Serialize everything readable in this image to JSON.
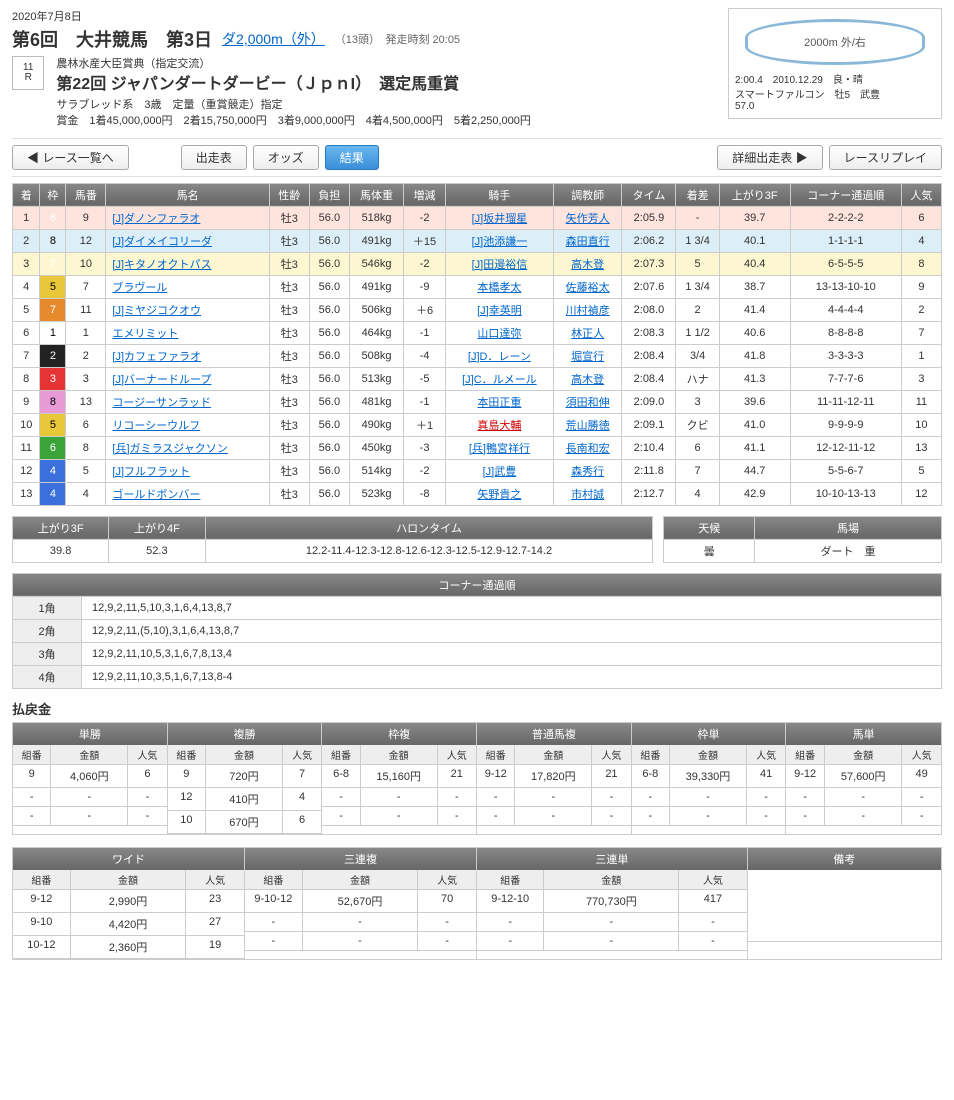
{
  "header": {
    "date": "2020年7月8日",
    "meeting": "第6回　大井競馬　第3日",
    "dist": "ダ2,000m（外）",
    "info": "（13頭）　発走時刻 20:05",
    "sub1": "農林水産大臣賞典（指定交流）",
    "race_name": "第22回 ジャパンダートダービー（ＪｐｎI）　選定馬重賞",
    "sub2": "サラブレッド系　3歳　定量（重賞競走）指定",
    "prize": "賞金　1着45,000,000円　2着15,750,000円　3着9,000,000円　4着4,500,000円　5着2,250,000円",
    "race_num": "11",
    "race_num_sub": "R"
  },
  "record": {
    "oval": "2000m  外/右",
    "line1": "2:00.4　2010.12.29　良・晴",
    "line2": "スマートファルコン　牡5　武豊",
    "line3": "57.0"
  },
  "tabs": {
    "back": "◀ レース一覧へ",
    "t1": "出走表",
    "t2": "オッズ",
    "t3": "結果",
    "r1": "詳細出走表 ▶",
    "r2": "レースリプレイ"
  },
  "cols": [
    "着",
    "枠",
    "馬番",
    "馬名",
    "性齢",
    "負担",
    "馬体重",
    "増減",
    "騎手",
    "調教師",
    "タイム",
    "着差",
    "上がり3F",
    "コーナー通過順",
    "人気"
  ],
  "rows": [
    {
      "p": "1",
      "w": 6,
      "n": 9,
      "name": "[J]ダノンファラオ",
      "sa": "牡3",
      "wt": "56.0",
      "bw": "518kg",
      "d": "-2",
      "j": "[J]坂井瑠星",
      "t": "矢作芳人",
      "time": "2:05.9",
      "mg": "-",
      "f3": "39.7",
      "cn": "2-2-2-2",
      "pop": "6"
    },
    {
      "p": "2",
      "w": 8,
      "n": 12,
      "name": "[J]ダイメイコリーダ",
      "sa": "牡3",
      "wt": "56.0",
      "bw": "491kg",
      "d": "＋15",
      "j": "[J]池添謙一",
      "t": "森田直行",
      "time": "2:06.2",
      "mg": "1 3/4",
      "f3": "40.1",
      "cn": "1-1-1-1",
      "pop": "4"
    },
    {
      "p": "3",
      "w": 7,
      "n": 10,
      "name": "[J]キタノオクトパス",
      "sa": "牡3",
      "wt": "56.0",
      "bw": "546kg",
      "d": "-2",
      "j": "[J]田邊裕信",
      "t": "高木登",
      "time": "2:07.3",
      "mg": "5",
      "f3": "40.4",
      "cn": "6-5-5-5",
      "pop": "8"
    },
    {
      "p": "4",
      "w": 5,
      "n": 7,
      "name": "ブラヴール",
      "sa": "牡3",
      "wt": "56.0",
      "bw": "491kg",
      "d": "-9",
      "j": "本橋孝太",
      "t": "佐藤裕太",
      "time": "2:07.6",
      "mg": "1 3/4",
      "f3": "38.7",
      "cn": "13-13-10-10",
      "pop": "9"
    },
    {
      "p": "5",
      "w": 7,
      "n": 11,
      "name": "[J]ミヤジコクオウ",
      "sa": "牡3",
      "wt": "56.0",
      "bw": "506kg",
      "d": "＋6",
      "j": "[J]幸英明",
      "t": "川村禎彦",
      "time": "2:08.0",
      "mg": "2",
      "f3": "41.4",
      "cn": "4-4-4-4",
      "pop": "2"
    },
    {
      "p": "6",
      "w": 1,
      "n": 1,
      "name": "エメリミット",
      "sa": "牡3",
      "wt": "56.0",
      "bw": "464kg",
      "d": "-1",
      "j": "山口達弥",
      "t": "林正人",
      "time": "2:08.3",
      "mg": "1 1/2",
      "f3": "40.6",
      "cn": "8-8-8-8",
      "pop": "7"
    },
    {
      "p": "7",
      "w": 2,
      "n": 2,
      "name": "[J]カフェファラオ",
      "sa": "牡3",
      "wt": "56.0",
      "bw": "508kg",
      "d": "-4",
      "j": "[J]D．レーン",
      "t": "堀宣行",
      "time": "2:08.4",
      "mg": "3/4",
      "f3": "41.8",
      "cn": "3-3-3-3",
      "pop": "1"
    },
    {
      "p": "8",
      "w": 3,
      "n": 3,
      "name": "[J]バーナードループ",
      "sa": "牡3",
      "wt": "56.0",
      "bw": "513kg",
      "d": "-5",
      "j": "[J]C．ルメール",
      "t": "高木登",
      "time": "2:08.4",
      "mg": "ハナ",
      "f3": "41.3",
      "cn": "7-7-7-6",
      "pop": "3"
    },
    {
      "p": "9",
      "w": 8,
      "n": 13,
      "name": "コージーサンラッド",
      "sa": "牡3",
      "wt": "56.0",
      "bw": "481kg",
      "d": "-1",
      "j": "本田正重",
      "t": "須田和伸",
      "time": "2:09.0",
      "mg": "3",
      "f3": "39.6",
      "cn": "11-11-12-11",
      "pop": "11"
    },
    {
      "p": "10",
      "w": 5,
      "n": 6,
      "name": "リコーシーウルフ",
      "sa": "牡3",
      "wt": "56.0",
      "bw": "490kg",
      "d": "＋1",
      "j": "真島大輔",
      "t": "荒山勝徳",
      "time": "2:09.1",
      "mg": "クビ",
      "f3": "41.0",
      "cn": "9-9-9-9",
      "pop": "10",
      "jred": true
    },
    {
      "p": "11",
      "w": 6,
      "n": 8,
      "name": "[兵]ガミラスジャクソン",
      "sa": "牡3",
      "wt": "56.0",
      "bw": "450kg",
      "d": "-3",
      "j": "[兵]鴨宮祥行",
      "t": "長南和宏",
      "time": "2:10.4",
      "mg": "6",
      "f3": "41.1",
      "cn": "12-12-11-12",
      "pop": "13"
    },
    {
      "p": "12",
      "w": 4,
      "n": 5,
      "name": "[J]フルフラット",
      "sa": "牡3",
      "wt": "56.0",
      "bw": "514kg",
      "d": "-2",
      "j": "[J]武豊",
      "t": "森秀行",
      "time": "2:11.8",
      "mg": "7",
      "f3": "44.7",
      "cn": "5-5-6-7",
      "pop": "5"
    },
    {
      "p": "13",
      "w": 4,
      "n": 4,
      "name": "ゴールドボンバー",
      "sa": "牡3",
      "wt": "56.0",
      "bw": "523kg",
      "d": "-8",
      "j": "矢野貴之",
      "t": "市村誠",
      "time": "2:12.7",
      "mg": "4",
      "f3": "42.9",
      "cn": "10-10-13-13",
      "pop": "12"
    }
  ],
  "lap": {
    "h": [
      "上がり3F",
      "上がり4F",
      "ハロンタイム"
    ],
    "v": [
      "39.8",
      "52.3",
      "12.2-11.4-12.3-12.8-12.6-12.3-12.5-12.9-12.7-14.2"
    ]
  },
  "cond": {
    "h": [
      "天候",
      "馬場"
    ],
    "v": [
      "曇",
      "ダート　重"
    ]
  },
  "corner": {
    "title": "コーナー通過順",
    "rows": [
      [
        "1角",
        "12,9,2,11,5,10,3,1,6,4,13,8,7"
      ],
      [
        "2角",
        "12,9,2,11,(5,10),3,1,6,4,13,8,7"
      ],
      [
        "3角",
        "12,9,2,11,10,5,3,1,6,7,8,13,4"
      ],
      [
        "4角",
        "12,9,2,11,10,3,5,1,6,7,13,8-4"
      ]
    ]
  },
  "pay_title": "払戻金",
  "pay_types": [
    "単勝",
    "複勝",
    "枠複",
    "普通馬複",
    "枠単",
    "馬単"
  ],
  "pay_sub": [
    "組番",
    "金額",
    "人気"
  ],
  "pay": [
    [
      [
        "9",
        "4,060円",
        "6"
      ],
      [
        "-",
        "-",
        "-"
      ],
      [
        "-",
        "-",
        "-"
      ]
    ],
    [
      [
        "9",
        "720円",
        "7"
      ],
      [
        "12",
        "410円",
        "4"
      ],
      [
        "10",
        "670円",
        "6"
      ]
    ],
    [
      [
        "6-8",
        "15,160円",
        "21"
      ],
      [
        "-",
        "-",
        "-"
      ],
      [
        "-",
        "-",
        "-"
      ]
    ],
    [
      [
        "9-12",
        "17,820円",
        "21"
      ],
      [
        "-",
        "-",
        "-"
      ],
      [
        "-",
        "-",
        "-"
      ]
    ],
    [
      [
        "6-8",
        "39,330円",
        "41"
      ],
      [
        "-",
        "-",
        "-"
      ],
      [
        "-",
        "-",
        "-"
      ]
    ],
    [
      [
        "9-12",
        "57,600円",
        "49"
      ],
      [
        "-",
        "-",
        "-"
      ],
      [
        "-",
        "-",
        "-"
      ]
    ]
  ],
  "pay2_types": [
    "ワイド",
    "三連複",
    "三連単",
    "備考"
  ],
  "pay2": [
    [
      [
        "9-12",
        "2,990円",
        "23"
      ],
      [
        "9-10",
        "4,420円",
        "27"
      ],
      [
        "10-12",
        "2,360円",
        "19"
      ]
    ],
    [
      [
        "9-10-12",
        "52,670円",
        "70"
      ],
      [
        "-",
        "-",
        "-"
      ],
      [
        "-",
        "-",
        "-"
      ]
    ],
    [
      [
        "9-12-10",
        "770,730円",
        "417"
      ],
      [
        "-",
        "-",
        "-"
      ],
      [
        "-",
        "-",
        "-"
      ]
    ],
    [
      [
        "",
        "",
        ""
      ],
      [
        "",
        "",
        ""
      ],
      [
        "",
        "",
        ""
      ]
    ]
  ]
}
